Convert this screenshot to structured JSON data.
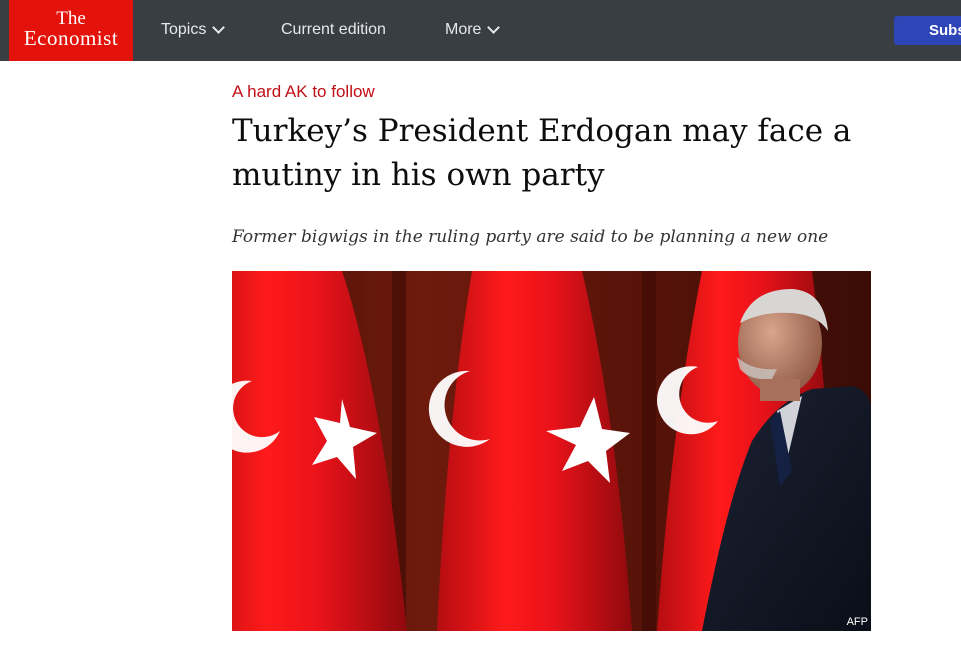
{
  "brand": {
    "logo_line1": "The",
    "logo_line2": "Economist",
    "color": "#e3120b"
  },
  "nav": {
    "items": [
      {
        "label": "Topics",
        "has_dropdown": true,
        "icon": "chevron-down-icon"
      },
      {
        "label": "Current edition",
        "has_dropdown": false
      },
      {
        "label": "More",
        "has_dropdown": true,
        "icon": "chevron-down-icon"
      }
    ],
    "subscribe_label": "Subsc",
    "background": "#383e42"
  },
  "article": {
    "rubric": "A hard AK to follow",
    "headline": "Turkey’s President Erdogan may face a mutiny in his own party",
    "standfirst": "Former bigwigs in the ruling party are said to be planning a new one",
    "image_credit": "AFP",
    "rubric_color": "#c00f15"
  }
}
